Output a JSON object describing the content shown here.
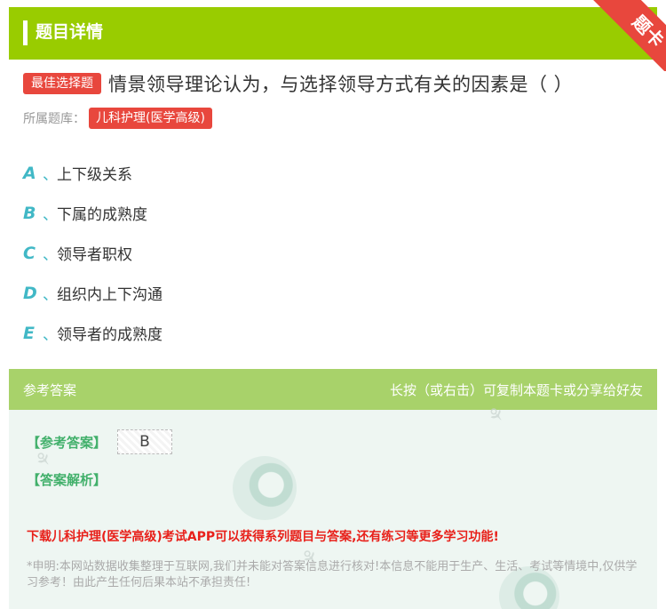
{
  "header": {
    "title": "题目详情",
    "ribbon": "题卡"
  },
  "question": {
    "type_badge": "最佳选择题",
    "text": "情景领导理论认为，与选择领导方式有关的因素是（ ）",
    "library_label": "所属题库：",
    "library_name": "儿科护理(医学高级)"
  },
  "options": [
    {
      "letter": "A",
      "sep": "、",
      "text": "上下级关系"
    },
    {
      "letter": "B",
      "sep": "、",
      "text": "下属的成熟度"
    },
    {
      "letter": "C",
      "sep": "、",
      "text": "领导者职权"
    },
    {
      "letter": "D",
      "sep": "、",
      "text": "组织内上下沟通"
    },
    {
      "letter": "E",
      "sep": "、",
      "text": "领导者的成熟度"
    }
  ],
  "answer": {
    "head_left": "参考答案",
    "head_right": "长按（或右击）可复制本题卡或分享给好友",
    "answer_label": "【参考答案】",
    "answer_value": "B",
    "explain_label": "【答案解析】",
    "promo": "下载儿科护理(医学高级)考试APP可以获得系列题目与答案,还有练习等更多学习功能!",
    "disclaimer": "*申明:本网站数据收集整理于互联网,我们并未能对答案信息进行核对!本信息不能用于生产、生活、考试等情境中,仅供学习参考！由此产生任何后果本站不承担责任!"
  },
  "colors": {
    "brand_green": "#99cc00",
    "accent_red": "#e8473d",
    "option_teal": "#41b8c6",
    "answer_green": "#42b06b"
  }
}
